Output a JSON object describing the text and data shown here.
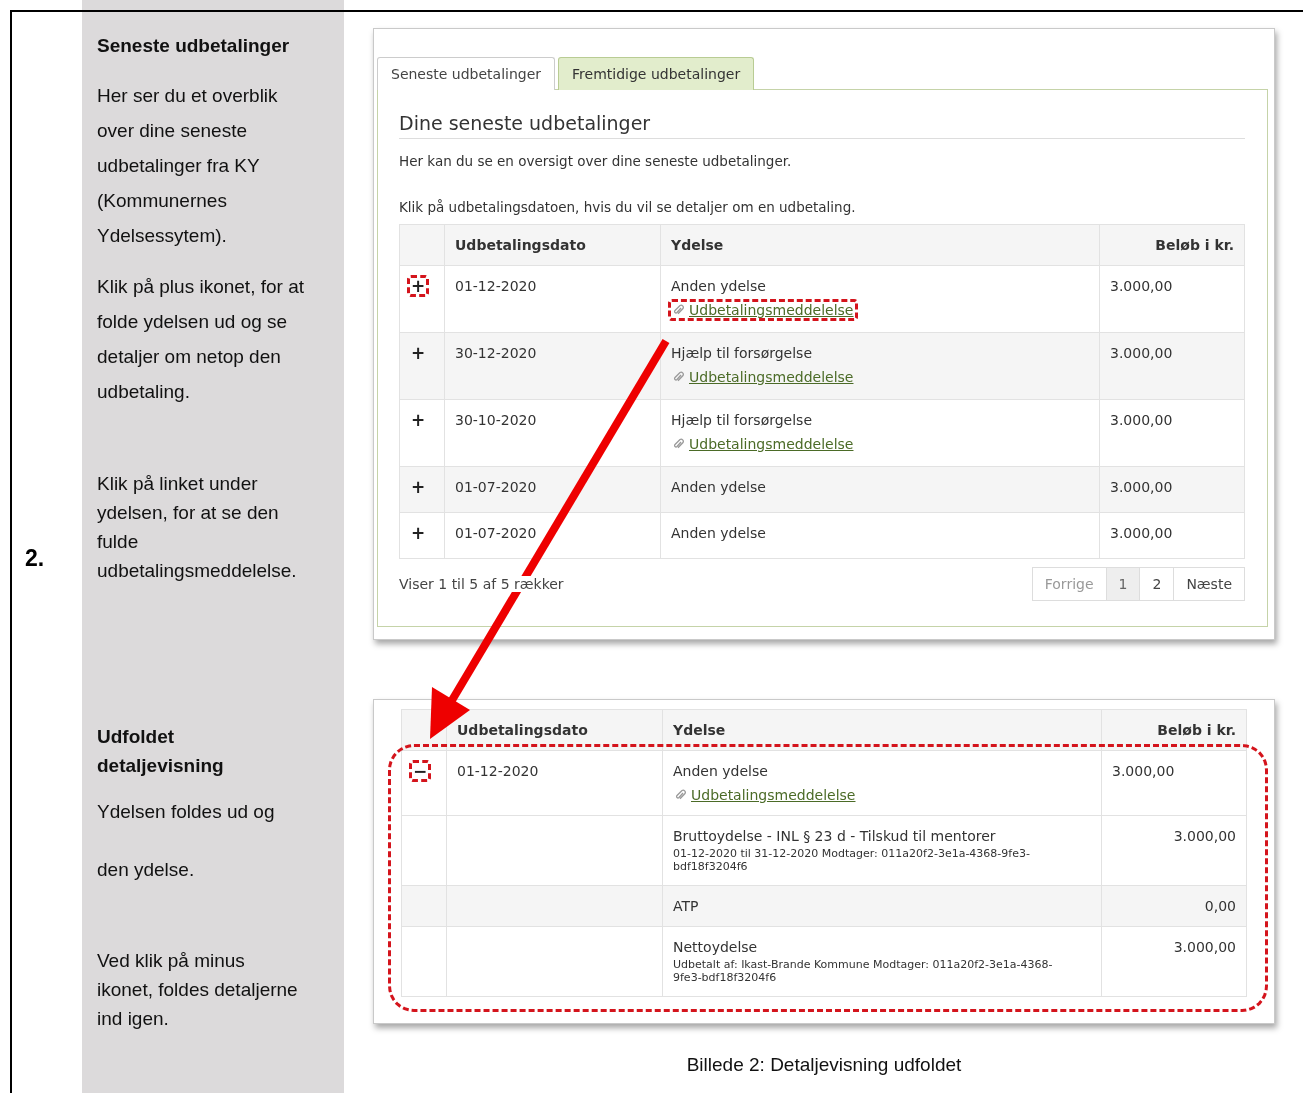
{
  "section_number": "2.",
  "notes": [
    {
      "kind": "heading",
      "text": "Seneste udbetalinger"
    },
    {
      "kind": "paragraph",
      "text": "Her ser du et overblik over dine seneste udbetalinger fra KY (Kommunernes Ydelsessytem)."
    },
    {
      "kind": "paragraph",
      "text": "Klik på plus ikonet, for at folde ydelsen ud og se detaljer om netop den udbetaling."
    },
    {
      "kind": "paragraph",
      "text": "Klik på linket under ydelsen, for at se den fulde udbetalingsmeddelelse."
    },
    {
      "kind": "heading",
      "text": "Udfoldet detaljevisning"
    },
    {
      "kind": "paragraph",
      "text": "Ydelsen foldes ud og"
    },
    {
      "kind": "paragraph",
      "text": "den ydelse."
    },
    {
      "kind": "paragraph",
      "text": "Ved klik på minus ikonet, foldes detaljerne ind igen."
    }
  ],
  "overview_panel": {
    "tabs": [
      {
        "label": "Seneste udbetalinger",
        "selected": true
      },
      {
        "label": "Fremtidige udbetalinger",
        "selected": false
      }
    ],
    "title": "Dine seneste udbetalinger",
    "intro": [
      "Her kan du se en oversigt over dine seneste udbetalinger.",
      "Klik på udbetalingsdatoen, hvis du vil se detaljer om en udbetaling."
    ],
    "columns": [
      "Udbetalingsdato",
      "Ydelse",
      "Beløb i kr."
    ],
    "rows": [
      {
        "toggle": {
          "symbol": "+",
          "highlighted": true
        },
        "date": "01-12-2020",
        "benefit": "Anden ydelse",
        "link": {
          "text": "Udbetalingsmeddelelse",
          "highlighted": true
        },
        "amount": "3.000,00"
      },
      {
        "toggle": {
          "symbol": "+",
          "highlighted": false
        },
        "date": "30-12-2020",
        "benefit": "Hjælp til forsørgelse",
        "link": {
          "text": "Udbetalingsmeddelelse",
          "highlighted": false
        },
        "amount": "3.000,00"
      },
      {
        "toggle": {
          "symbol": "+",
          "highlighted": false
        },
        "date": "30-10-2020",
        "benefit": "Hjælp til forsørgelse",
        "link": {
          "text": "Udbetalingsmeddelelse",
          "highlighted": false
        },
        "amount": "3.000,00"
      },
      {
        "toggle": {
          "symbol": "+",
          "highlighted": false
        },
        "date": "01-07-2020",
        "benefit": "Anden ydelse",
        "amount": "3.000,00"
      },
      {
        "toggle": {
          "symbol": "+",
          "highlighted": false
        },
        "date": "01-07-2020",
        "benefit": "Anden ydelse",
        "amount": "3.000,00"
      }
    ],
    "footer": "Viser 1 til 5 af 5 rækker",
    "pagination": [
      {
        "label": "Forrige",
        "selected": false,
        "disabled": true
      },
      {
        "label": "1",
        "selected": true,
        "disabled": false
      },
      {
        "label": "2",
        "selected": false,
        "disabled": false
      },
      {
        "label": "Næste",
        "selected": false,
        "disabled": false
      }
    ]
  },
  "detail_panel": {
    "columns": [
      "Udbetalingsdato",
      "Ydelse",
      "Beløb i kr."
    ],
    "rows": [
      {
        "toggle": {
          "symbol": "−",
          "highlighted": true
        },
        "date": "01-12-2020",
        "benefit": "Anden ydelse",
        "link": {
          "text": "Udbetalingsmeddelelse",
          "highlighted": false
        },
        "amount": "3.000,00"
      }
    ],
    "details": [
      {
        "title": "Bruttoydelse - INL § 23 d - Tilskud til mentorer",
        "subtitle": "01-12-2020 til 31-12-2020 Modtager: 011a20f2-3e1a-4368-9fe3-bdf18f3204f6",
        "amount": "3.000,00"
      },
      {
        "title": "ATP",
        "amount": "0,00"
      },
      {
        "title": "Nettoydelse",
        "subtitle": "Udbetalt af: Ikast-Brande Kommune Modtager: 011a20f2-3e1a-4368-9fe3-bdf18f3204f6",
        "amount": "3.000,00"
      }
    ],
    "highlighted": true
  },
  "caption": "Billede 2: Detaljevisning udfoldet"
}
